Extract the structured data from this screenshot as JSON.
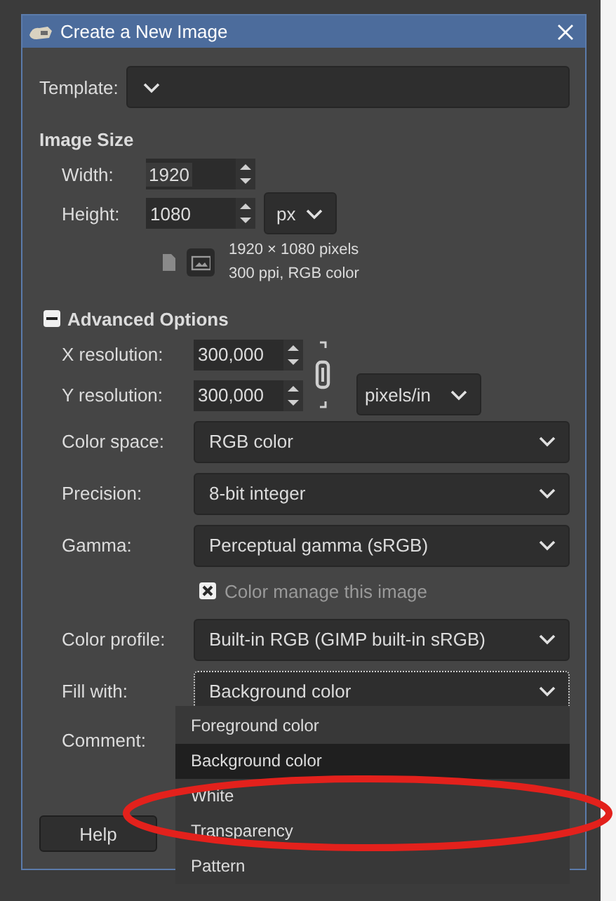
{
  "window": {
    "title": "Create a New Image"
  },
  "template": {
    "label": "Template:"
  },
  "image_size": {
    "heading": "Image Size",
    "width": {
      "label": "Width:",
      "value": "1920"
    },
    "height": {
      "label": "Height:",
      "value": "1080"
    },
    "unit": "px",
    "orientations": [
      {
        "selected": false
      },
      {
        "selected": true
      }
    ],
    "info": [
      "1920 × 1080 pixels",
      "300 ppi, RGB color"
    ]
  },
  "advanced": {
    "heading": "Advanced Options",
    "expanded": true,
    "x_resolution": {
      "label": "X resolution:",
      "value": "300,000"
    },
    "y_resolution": {
      "label": "Y resolution:",
      "value": "300,000"
    },
    "unit": "pixels/in",
    "fields": [
      {
        "kind": "combo",
        "label": "Color space:",
        "value": "RGB color",
        "focused": false
      },
      {
        "kind": "combo",
        "label": "Precision:",
        "value": "8-bit integer",
        "focused": false
      },
      {
        "kind": "combo",
        "label": "Gamma:",
        "value": "Perceptual gamma (sRGB)",
        "focused": false
      },
      {
        "kind": "checkbox",
        "label": "Color manage this image",
        "checked": true
      },
      {
        "kind": "combo",
        "label": "Color profile:",
        "value": "Built-in RGB (GIMP built-in sRGB)",
        "focused": false
      },
      {
        "kind": "combo",
        "label": "Fill with:",
        "value": "Background color",
        "focused": true
      },
      {
        "kind": "text",
        "label": "Comment:"
      }
    ]
  },
  "fill_menu": {
    "items": [
      {
        "label": "Foreground color",
        "selected": false
      },
      {
        "label": "Background color",
        "selected": true
      },
      {
        "label": "White",
        "selected": false
      },
      {
        "label": "Transparency",
        "selected": false
      },
      {
        "label": "Pattern",
        "selected": false
      }
    ]
  },
  "buttons": [
    {
      "label": "Help"
    }
  ]
}
